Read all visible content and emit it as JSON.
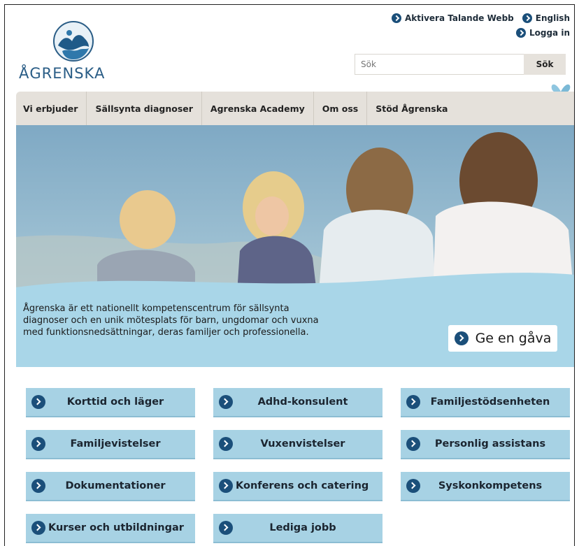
{
  "header": {
    "logo_text": "ÅGRENSKA",
    "links": {
      "speech": "Aktivera Talande Webb",
      "language": "English",
      "login": "Logga in"
    },
    "search": {
      "placeholder": "Sök",
      "button": "Sök"
    }
  },
  "nav": {
    "items": [
      {
        "label": "Vi erbjuder"
      },
      {
        "label": "Sällsynta diagnoser"
      },
      {
        "label": "Agrenska Academy"
      },
      {
        "label": "Om oss"
      },
      {
        "label": "Stöd Ågrenska"
      }
    ]
  },
  "hero": {
    "text": "Ågrenska är ett nationellt kompetenscentrum för sällsynta diagnoser och en unik mötesplats för barn, ungdomar och vuxna med funktionsnedsättningar, deras familjer och professionella.",
    "give_button": "Ge en gåva"
  },
  "tiles": [
    {
      "label": "Korttid och läger"
    },
    {
      "label": "Adhd-konsulent"
    },
    {
      "label": "Familjestödsenheten"
    },
    {
      "label": "Familjevistelser"
    },
    {
      "label": "Vuxenvistelser"
    },
    {
      "label": "Personlig assistans"
    },
    {
      "label": "Dokumentationer"
    },
    {
      "label": "Konferens och catering"
    },
    {
      "label": "Syskonkompetens"
    },
    {
      "label": "Kurser och utbildningar"
    },
    {
      "label": "Lediga jobb"
    }
  ],
  "colors": {
    "accent": "#1b4f7a",
    "tile": "#a7d2e4",
    "nav": "#e5e1db",
    "hero_overlay": "#a9d6e8"
  }
}
